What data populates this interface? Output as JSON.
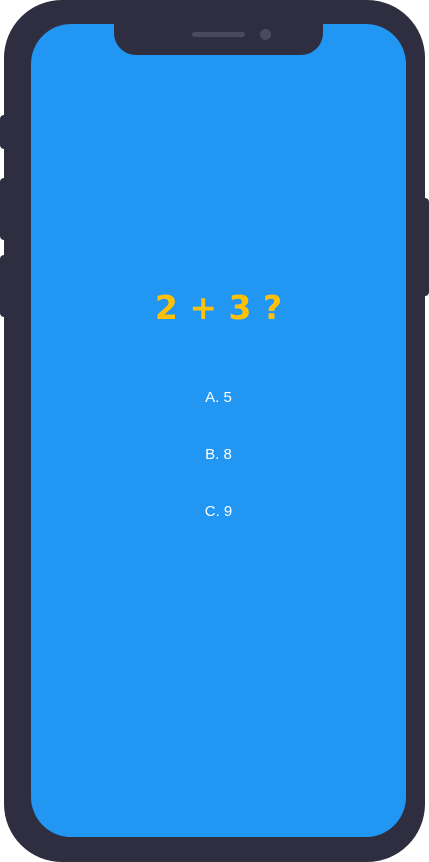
{
  "quiz": {
    "question": "2 + 3 ?",
    "options": [
      {
        "label": "A. 5"
      },
      {
        "label": "B. 8"
      },
      {
        "label": "C. 9"
      }
    ]
  },
  "colors": {
    "screen_background": "#2196f3",
    "question_text": "#ffc107",
    "option_text": "#ffffff",
    "device_frame": "#2e2e40"
  }
}
